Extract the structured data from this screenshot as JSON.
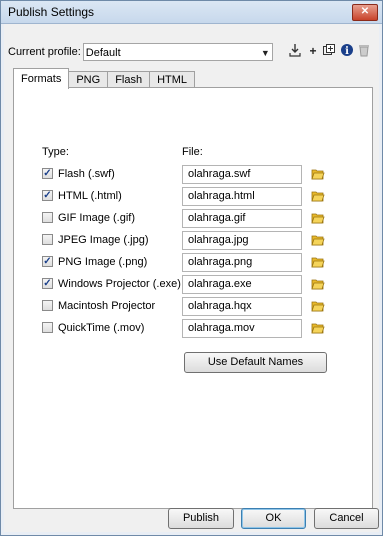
{
  "window": {
    "title": "Publish Settings",
    "close_glyph": "✕"
  },
  "profile": {
    "label": "Current profile:",
    "value": "Default",
    "tools": [
      "import-export-icon",
      "add-profile-icon",
      "duplicate-profile-icon",
      "profile-info-icon",
      "delete-profile-icon"
    ]
  },
  "tabs": [
    "Formats",
    "PNG",
    "Flash",
    "HTML"
  ],
  "headers": {
    "type": "Type:",
    "file": "File:"
  },
  "formats": [
    {
      "label": "Flash  (.swf)",
      "file": "olahraga.swf",
      "checked": true
    },
    {
      "label": "HTML  (.html)",
      "file": "olahraga.html",
      "checked": true
    },
    {
      "label": "GIF Image  (.gif)",
      "file": "olahraga.gif",
      "checked": false
    },
    {
      "label": "JPEG Image  (.jpg)",
      "file": "olahraga.jpg",
      "checked": false
    },
    {
      "label": "PNG Image  (.png)",
      "file": "olahraga.png",
      "checked": true
    },
    {
      "label": "Windows Projector (.exe)",
      "file": "olahraga.exe",
      "checked": true
    },
    {
      "label": "Macintosh Projector",
      "file": "olahraga.hqx",
      "checked": false
    },
    {
      "label": "QuickTime  (.mov)",
      "file": "olahraga.mov",
      "checked": false
    }
  ],
  "buttons": {
    "default_names": "Use Default Names",
    "publish": "Publish",
    "ok": "OK",
    "cancel": "Cancel"
  },
  "colors": {
    "folder": "#e8b92a",
    "check": "#1a3f8a",
    "title_bar": "#c7d8ec"
  }
}
